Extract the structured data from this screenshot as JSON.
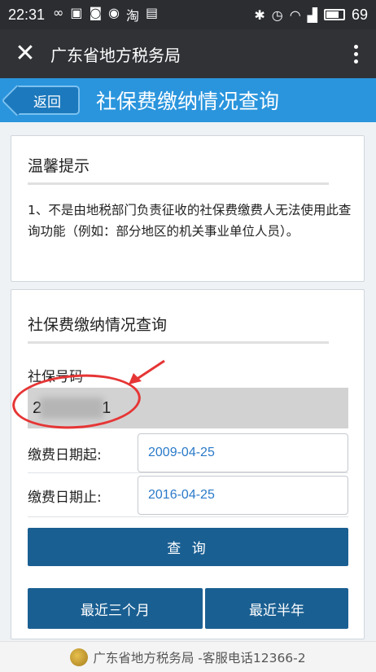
{
  "status_bar": {
    "time": "22:31",
    "battery": "69",
    "left_icons": [
      "infinity-icon",
      "image-icon",
      "app-icon",
      "app-icon",
      "taobao-icon",
      "sim-icon"
    ],
    "right_icons": [
      "bluetooth-icon",
      "alarm-icon",
      "wifi-icon",
      "signal-icon",
      "battery-icon"
    ]
  },
  "wechat_header": {
    "close_icon": "close-icon",
    "title": "广东省地方税务局",
    "more_icon": "more-icon"
  },
  "app_header": {
    "back_label": "返回",
    "title": "社保费缴纳情况查询"
  },
  "tips_card": {
    "title": "温馨提示",
    "body": "1、不是由地税部门负责征收的社保费缴费人无法使用此查询功能（例如：部分地区的机关事业单位人员）。"
  },
  "query_card": {
    "title": "社保费缴纳情况查询",
    "social_security_label": "社保号码",
    "social_security_value_start": "2",
    "social_security_value_end": "1",
    "start_date_label": "缴费日期起:",
    "start_date_value": "2009-04-25",
    "end_date_label": "缴费日期止:",
    "end_date_value": "2016-04-25",
    "query_button": "查 询",
    "recent_3_months_button": "最近三个月",
    "recent_half_year_button": "最近半年"
  },
  "footer": {
    "text": "广东省地方税务局 -客服电话12366-2"
  },
  "colors": {
    "status_bar": "#2b2d31",
    "wechat_header": "#303236",
    "app_header": "#2a95dd",
    "button": "#1a5f92",
    "annotation": "#e63535"
  }
}
